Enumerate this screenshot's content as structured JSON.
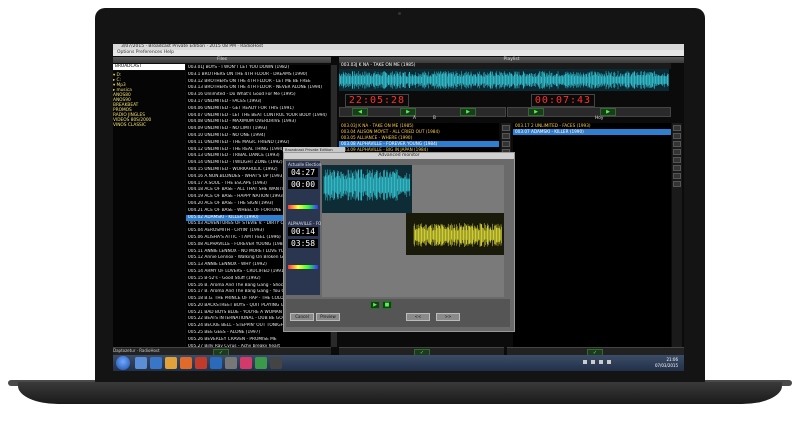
{
  "window": {
    "title": "3/07/2015 · Broadcast Private Edition · 2015 08 PM · RadioHost",
    "menu": "Options   Preferences   Help"
  },
  "files": {
    "header": "Files",
    "source_dropdown": "BROADCAST",
    "tree": [
      "▾ D:",
      "▸ C:",
      "  ▾ Mp3",
      "    ▸ musica",
      "      ANOS80",
      "      ANOS90",
      "      BREAKBEAT",
      "      PROMOS",
      "      RADIO JINGLES",
      "      VIDEOS 80S/2000",
      "      VINOS CLASSIC"
    ],
    "rows": [
      "003.01J BOYS - I WON'T LET YOU DOWN (1982)",
      "003.1 BROTHERS ON THE 4TH FLOOR - DREAMS (1990)",
      "003.12 BROTHERS ON THE 4TH FLOOR - LET ME BE FREE",
      "003.13 BROTHERS ON THE 4TH FLOOR - NEVER ALONE (1994)",
      "003.16 Unlimited - Do What's Good For Me (1995)",
      "003.17 UNLIMITED - FACES (1993)",
      "004.06 UNLIMITED - GET READY FOR THIS (1991)",
      "004.07 UNLIMITED - LET THE BEAT CONTROL YOUR BODY (1994)",
      "004.08 UNLIMITED - MAXIMUM OVERDRIVE (1993)",
      "004.09 UNLIMITED - NO LIMIT (1993)",
      "004.10 UNLIMITED - NO ONE (1994)",
      "004.11 UNLIMITED - THE MAGIC FRIEND (1992)",
      "004.12 UNLIMITED - THE REAL THING (1994)",
      "004.13 UNLIMITED - TRIBAL DANCE (1993)",
      "004.14 UNLIMITED - TWILIGHT ZONE (1992)",
      "004.15 UNLIMITED - WORKAHOLIC (1992)",
      "004.16 A.NON.BLONDES - WHAT'S UP (1993)",
      "004.17 A.SOUL - THE ESCAPE (1993)",
      "004.18 ACE OF BASE - ALL THAT SHE WANTS (1993)",
      "004.19 ACE OF BASE - HAPPY NATION (1993)",
      "004.20 ACE OF BASE - THE SIGN (1993)",
      "004.21 ACE OF BASE - WHEEL OF FORTUNE (1993)",
      "005.02 ADAMSKI - KILLER (1990)",
      "005.03 ADVENTURES OF STEVIE V. - DIRTY CASH",
      "005.04 AEROSMITH - CRYIN' (1993)",
      "005.06 ALISHA'S ATTIC - I AM I FEEL (1996)",
      "005.08 ALPHAVILLE - FOREVER YOUNG (1984)",
      "005.11 ANNIE LENNOX - NO MORE I LOVE YOU'S",
      "005.12 Annie Lennox - Walking On Broken Glass",
      "005.13 ANNIE LENNOX - WHY (1992)",
      "005.14 ARMY OF LOVERS - CRUCIFIED (1991)",
      "005.15 B-52's - Good Stuff (1992)",
      "005.16 B. Aroma And The Bang Gang - Shock",
      "005.17 B. Aroma And The Bang Gang - You Can",
      "005.18 B.G. THE PRINCE OF RAP - THE COLOUR",
      "005.20 BACKSTREET BOYS - QUIT PLAYING GAMES",
      "005.21 BAD BOYS BLUE - YOU'RE A WOMAN",
      "005.22 BEATS INTERNATIONAL - DUB BE GOOD",
      "005.24 BECKIE BELL - STEPPIN' OUT TONIGHT",
      "005.25 BEE GEES - ALONE (1997)",
      "005.26 BEVERLEY CRAVEN - PROMISE ME",
      "005.27 Billy Ray Cyrus - Achy breaky heart",
      "005.28 Bingo Boys - How To Dance",
      "005.30 BLACK BOX - RIDE ON TIME",
      "005.32 BLUEBELLS - YOUNG AT HEART (1993)",
      "005.33 BLUR - PARKLIFE (1994)"
    ],
    "highlighted_index": 22
  },
  "playlist": {
    "header": "Playlist",
    "now_playing": "003.03J K NA - TAKE ON ME (1985)",
    "left_time": "22:05:28",
    "right_time": "00:07:43",
    "tag_a": "A",
    "tag_b": "B",
    "left_rows": [
      "003.03J K NA - TAKE ON ME (1985)",
      "003.04 ALISON MOYET - ALL CRIED OUT (1984)",
      "003.05 ALLIANCE - WHERE (1990)",
      "003.08 ALPHAVILLE - FOREVER YOUNG (1984)",
      "003.09 ALPHAVILLE - BIG IN JAPAN (1984)"
    ],
    "left_selected": 3,
    "right_header": "Hoy",
    "right_rows": [
      "003.17 2 UNLIMITED - FACES (1993)",
      "003.07 ADAMSKI - KILLER (1990)"
    ],
    "right_selected": 1
  },
  "monitor": {
    "mini_title": "Broadcast Private Edition",
    "title": "Advanced monitor",
    "label_top": "Actualle  Election",
    "time1": "04:27",
    "time2": "00:00",
    "label_mid": "ALPHAVILLE - FO",
    "time3": "00:14",
    "time4": "03:58",
    "cancel": "Cancel",
    "preview": "Preview"
  },
  "taskbar": {
    "time": "21:06",
    "date": "07/03/2015",
    "app_label": "Daptozetur · RadioHost"
  },
  "colors": {
    "wave_cyan": "#35c8d8",
    "wave_yellow": "#e4e23a",
    "digits_red": "#ff3030",
    "selection_blue": "#2e7fcf"
  }
}
